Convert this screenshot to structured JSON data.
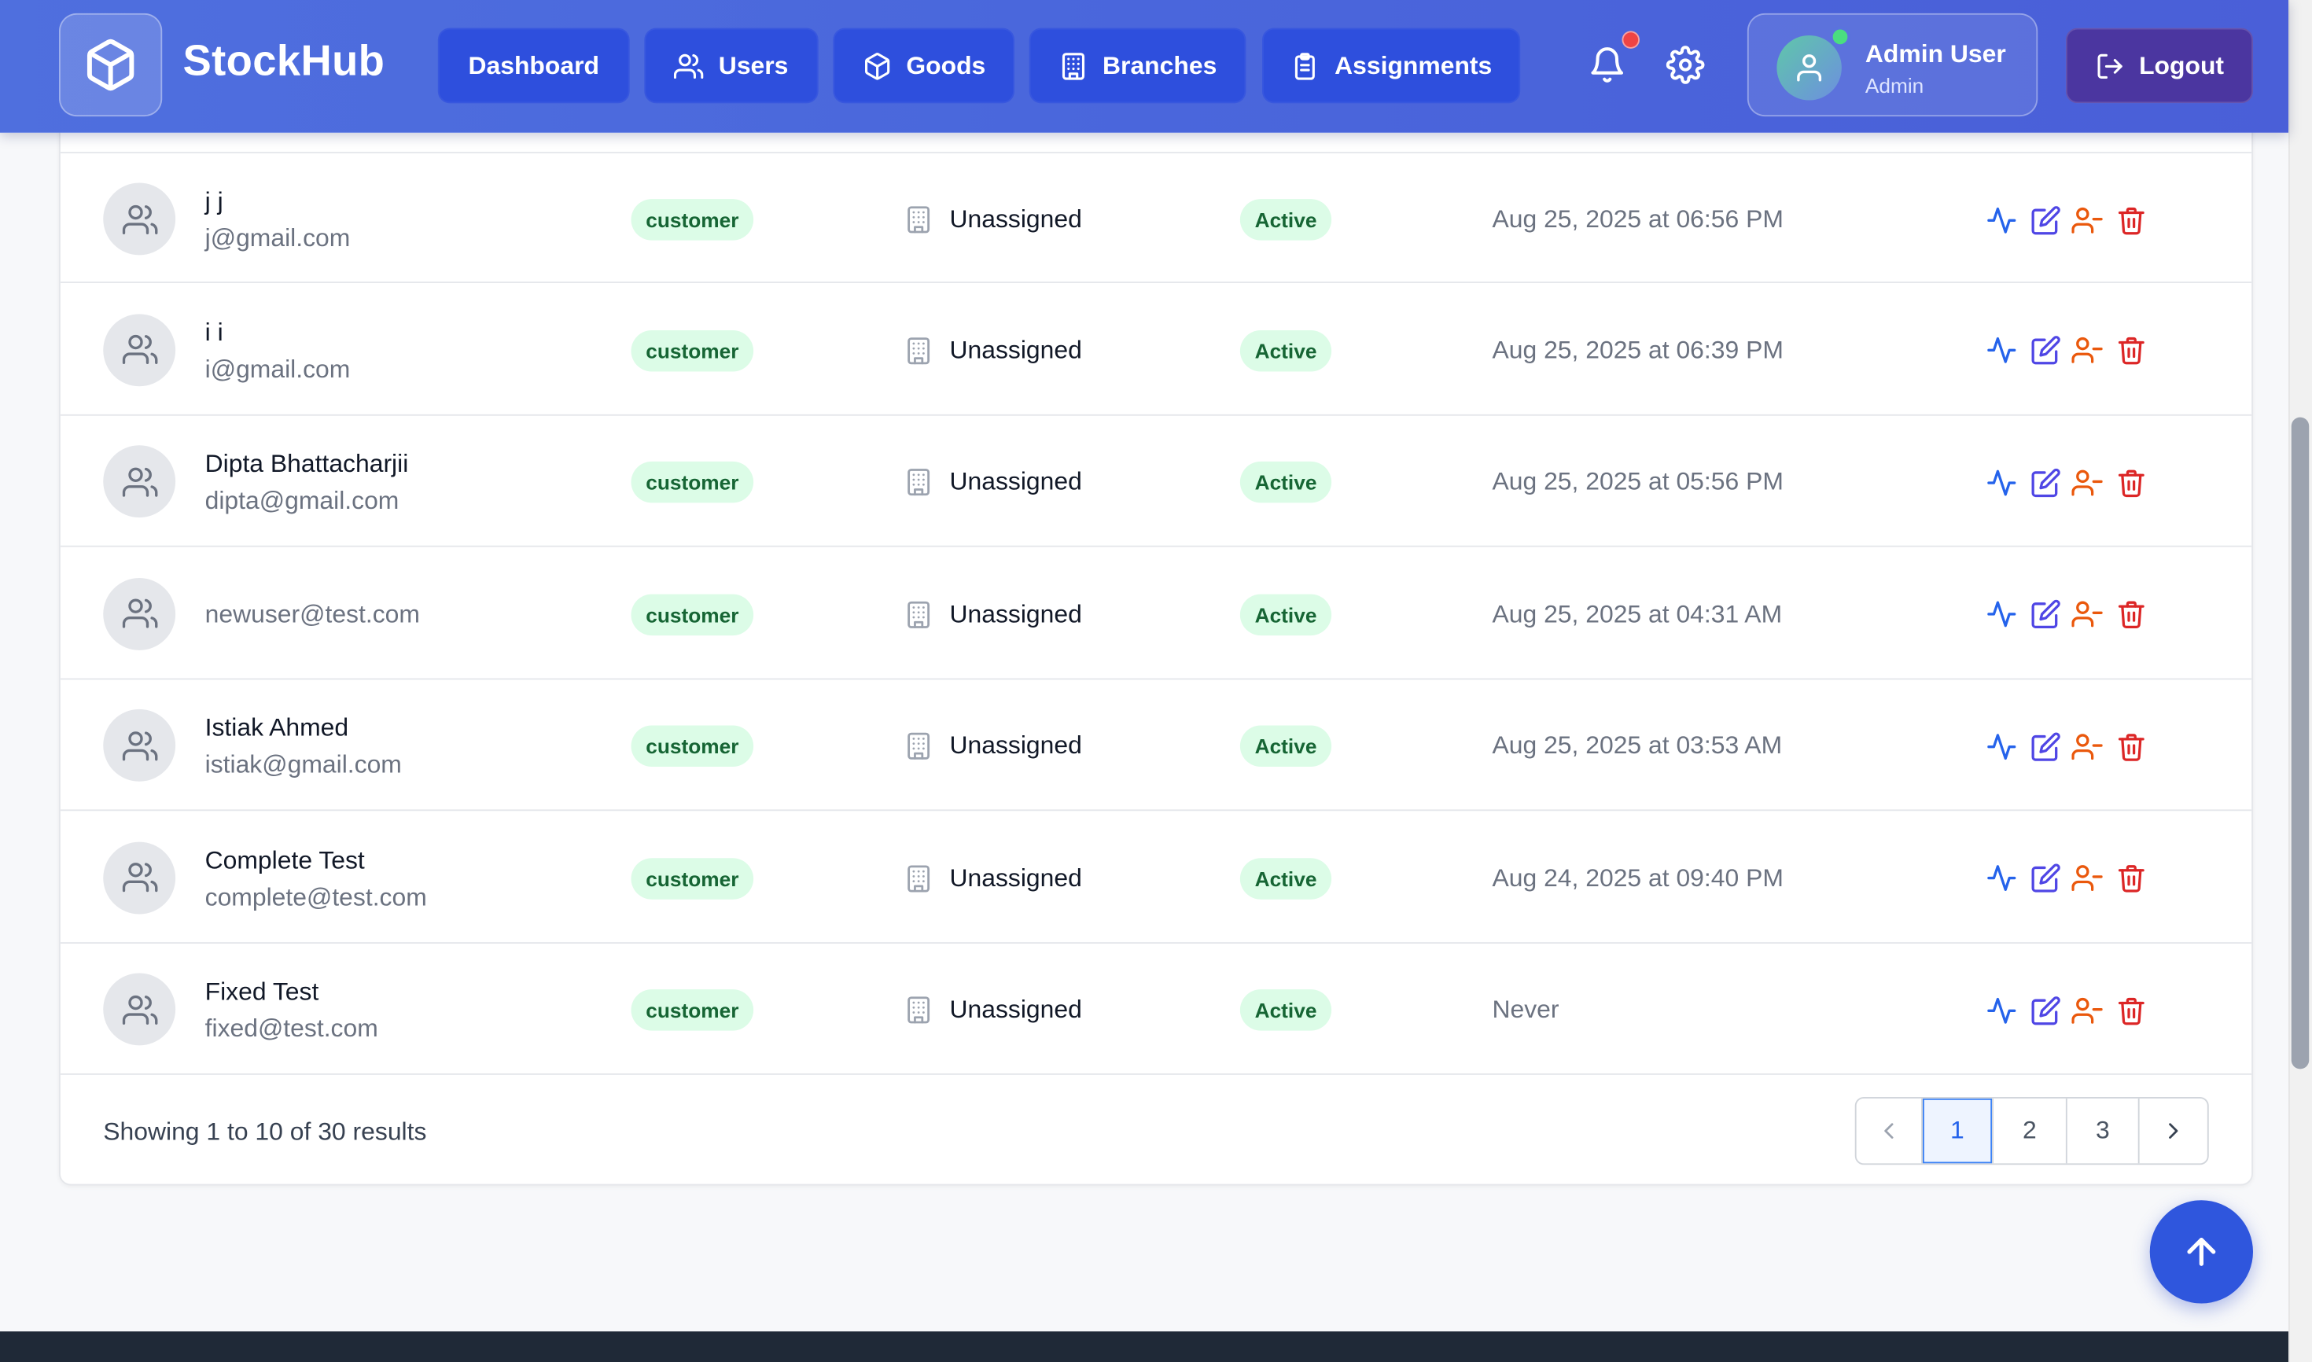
{
  "app": {
    "brand": "StockHub",
    "brand_color": "#4a67dc",
    "logo_icon": "cube-icon"
  },
  "nav": {
    "items": [
      {
        "label": "Dashboard",
        "icon": ""
      },
      {
        "label": "Users",
        "icon": "users-icon"
      },
      {
        "label": "Goods",
        "icon": "package-icon"
      },
      {
        "label": "Branches",
        "icon": "building-icon"
      },
      {
        "label": "Assignments",
        "icon": "clipboard-icon"
      }
    ]
  },
  "header": {
    "notifications_icon": "bell-icon",
    "settings_icon": "gear-icon",
    "user": {
      "name": "Admin User",
      "role": "Admin"
    },
    "logout_label": "Logout"
  },
  "users_table": {
    "rows": [
      {
        "name": "j j",
        "email": "j@gmail.com",
        "role": "customer",
        "branch": "Unassigned",
        "status": "Active",
        "last_login": "Aug 25, 2025 at 06:56 PM"
      },
      {
        "name": "i i",
        "email": "i@gmail.com",
        "role": "customer",
        "branch": "Unassigned",
        "status": "Active",
        "last_login": "Aug 25, 2025 at 06:39 PM"
      },
      {
        "name": "Dipta Bhattacharjii",
        "email": "dipta@gmail.com",
        "role": "customer",
        "branch": "Unassigned",
        "status": "Active",
        "last_login": "Aug 25, 2025 at 05:56 PM"
      },
      {
        "name": "",
        "email": "newuser@test.com",
        "role": "customer",
        "branch": "Unassigned",
        "status": "Active",
        "last_login": "Aug 25, 2025 at 04:31 AM"
      },
      {
        "name": "Istiak Ahmed",
        "email": "istiak@gmail.com",
        "role": "customer",
        "branch": "Unassigned",
        "status": "Active",
        "last_login": "Aug 25, 2025 at 03:53 AM"
      },
      {
        "name": "Complete Test",
        "email": "complete@test.com",
        "role": "customer",
        "branch": "Unassigned",
        "status": "Active",
        "last_login": "Aug 24, 2025 at 09:40 PM"
      },
      {
        "name": "Fixed Test",
        "email": "fixed@test.com",
        "role": "customer",
        "branch": "Unassigned",
        "status": "Active",
        "last_login": "Never"
      }
    ],
    "row_action_icons": [
      "activity-icon",
      "edit-icon",
      "user-minus-icon",
      "trash-icon"
    ],
    "status_color": "#166534",
    "badge_bg": "#dcfce7"
  },
  "pagination": {
    "summary_prefix": "Showing ",
    "from": "1",
    "summary_to": " to ",
    "to": "10",
    "summary_of": " of ",
    "total": "30",
    "summary_suffix": " results",
    "pages": [
      "1",
      "2",
      "3"
    ],
    "current_page": "1"
  },
  "scroll_top_icon": "arrow-up-icon"
}
